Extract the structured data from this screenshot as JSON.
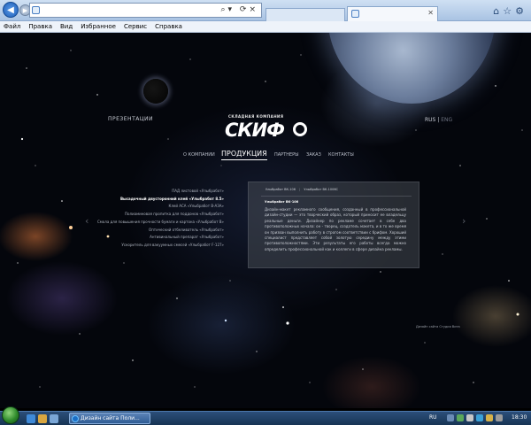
{
  "browser": {
    "address": "",
    "tab_title": "",
    "menu": [
      "Файл",
      "Правка",
      "Вид",
      "Избранное",
      "Сервис",
      "Справка"
    ]
  },
  "site": {
    "presentation": "ПРЕЗЕНТАЦИИ",
    "lang_active": "RUS",
    "lang_other": "ENG",
    "logo_subtitle": "СКЛАДНАЯ КОМПАНИЯ",
    "logo_text": "СКИФ",
    "nav": [
      "О КОМПАНИИ",
      "ПРОДУКЦИЯ",
      "ПАРТНЕРЫ",
      "ЗАКАЗ",
      "КОНТАКТЫ"
    ],
    "products": [
      "ПАД листовой «Улыбработ»",
      "Высадочный двусторонний клей «Улыбработ 8.5»",
      "Клей АСА «Улыбработ В-АЗА»",
      "Полиаминовая пропитка для поддонов «Улыбработ»",
      "Смола для повышения прочности бумаги и картона «Улыбработ В»",
      "Оптический отбеливатель «Улыбработ»",
      "Антивинальный препарат «Улыбработ»",
      "Ускоритель для вакуумных смесей «Улыбработ F-127»"
    ],
    "card": {
      "tab1": "Улыбработ ВК-106",
      "tab2": "Улыбработ ВК-1006С",
      "model": "Улыбработ ВК-106",
      "description": "Дизайн-макет рекламного сообщения, созданный в профессиональной дизайн-студии — это творческий образ, который приносит ее владельцу реальные деньги. Дизайнер по рекламе сочетает в себе два противоположных начала: он - творец, создатель макета, и в то же время он призван выполнить работу в строгом соответствии с брифом. Хороший специалист представляет собой золотую середину между этими противоположностями. Эти результаты его работы всегда можно определить профессиональной как и коллеги в сфере дизайна рекламы."
    },
    "credits": "Дизайн сайта Студия Вита"
  },
  "taskbar": {
    "window_title": "Дизайн сайта Поли...",
    "lang": "RU",
    "time": "18:30"
  }
}
